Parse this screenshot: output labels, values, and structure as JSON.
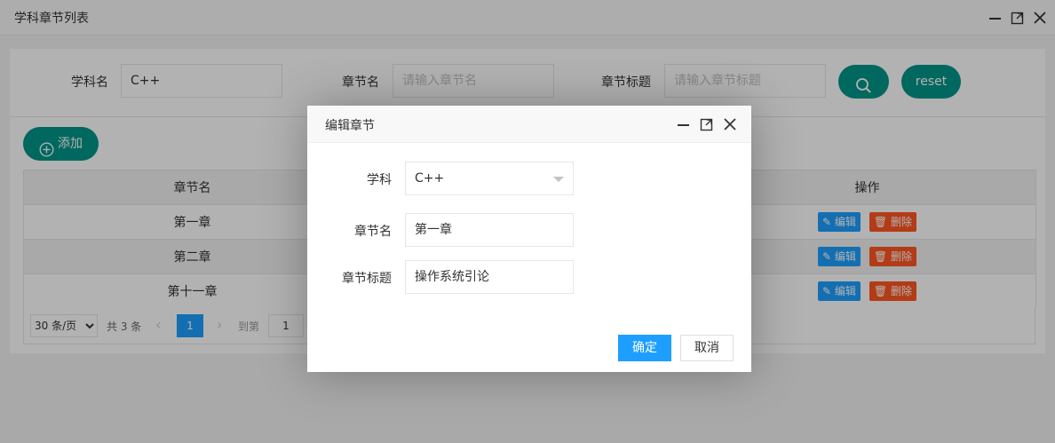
{
  "window": {
    "title": "学科章节列表"
  },
  "search": {
    "subject_label": "学科名",
    "subject_value": "C++",
    "chapter_label": "章节名",
    "chapter_placeholder": "请输入章节名",
    "chapter_title_label": "章节标题",
    "chapter_title_placeholder": "请输入章节标题",
    "reset_label": "reset"
  },
  "toolbar": {
    "add_label": "添加"
  },
  "table": {
    "headers": {
      "chapter_name": "章节名",
      "actions": "操作"
    },
    "rows": [
      {
        "chapter_name": "第一章",
        "edit": "编辑",
        "delete": "删除"
      },
      {
        "chapter_name": "第二章",
        "edit": "编辑",
        "delete": "删除"
      },
      {
        "chapter_name": "第十一章",
        "edit": "编辑",
        "delete": "删除"
      }
    ]
  },
  "pager": {
    "page_size": "30 条/页",
    "total": "共 3 条",
    "current_page": "1",
    "goto_label": "到第",
    "goto_value": "1"
  },
  "dialog": {
    "title": "编辑章节",
    "subject_label": "学科",
    "subject_value": "C++",
    "chapter_label": "章节名",
    "chapter_value": "第一章",
    "chapter_title_label": "章节标题",
    "chapter_title_value": "操作系统引论",
    "confirm_label": "确定",
    "cancel_label": "取消"
  },
  "colors": {
    "primary": "#009688",
    "blue": "#1e9fff",
    "danger": "#ff5722"
  }
}
